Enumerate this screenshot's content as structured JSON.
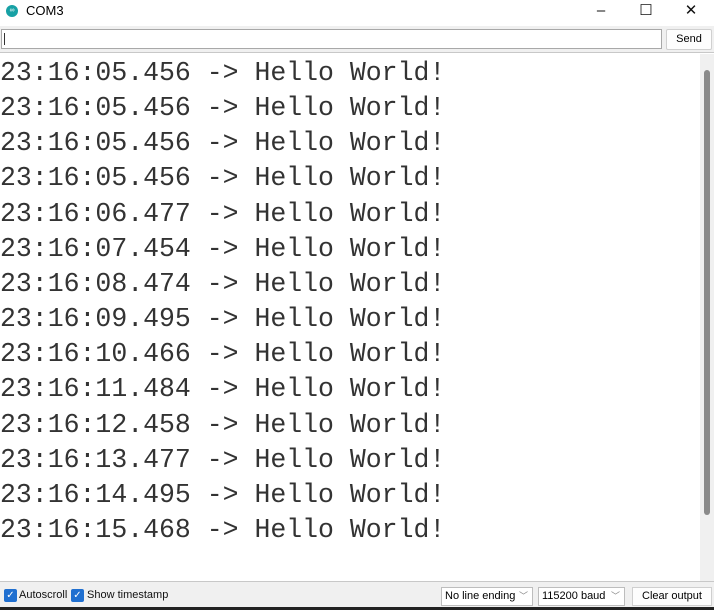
{
  "window": {
    "title": "COM3",
    "icon": "arduino-logo-icon",
    "minimize": "–",
    "maximize": "☐",
    "close": "✕"
  },
  "send_bar": {
    "input_value": "",
    "send_label": "Send"
  },
  "output": {
    "lines": [
      "23:16:05.456 -> Hello World!",
      "23:16:05.456 -> Hello World!",
      "23:16:05.456 -> Hello World!",
      "23:16:05.456 -> Hello World!",
      "23:16:06.477 -> Hello World!",
      "23:16:07.454 -> Hello World!",
      "23:16:08.474 -> Hello World!",
      "23:16:09.495 -> Hello World!",
      "23:16:10.466 -> Hello World!",
      "23:16:11.484 -> Hello World!",
      "23:16:12.458 -> Hello World!",
      "23:16:13.477 -> Hello World!",
      "23:16:14.495 -> Hello World!",
      "23:16:15.468 -> Hello World!"
    ]
  },
  "footer": {
    "autoscroll": {
      "label": "Autoscroll",
      "checked": true
    },
    "show_timestamp": {
      "label": "Show timestamp",
      "checked": true
    },
    "line_ending": "No line ending",
    "baud": "115200 baud",
    "clear_label": "Clear output"
  },
  "colors": {
    "accent": "#1f6fd0",
    "icon": "#17a1a5"
  }
}
